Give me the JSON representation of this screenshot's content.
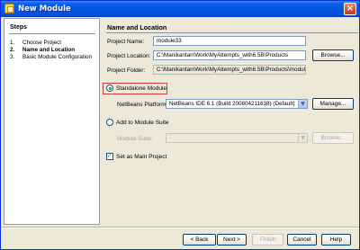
{
  "window": {
    "title": "New Module",
    "close_label": "×"
  },
  "steps": {
    "title": "Steps",
    "items": [
      {
        "num": "1.",
        "label": "Choose Project",
        "current": false
      },
      {
        "num": "2.",
        "label": "Name and Location",
        "current": true
      },
      {
        "num": "3.",
        "label": "Basic Module Configuration",
        "current": false
      }
    ]
  },
  "main": {
    "section_title": "Name and Location",
    "project_name": {
      "label": "Project Name:",
      "value": "module33"
    },
    "project_location": {
      "label": "Project Location:",
      "value": "C:\\Manikantan\\Work\\MyAttempts_with6.5B\\Products"
    },
    "project_folder": {
      "label": "Project Folder:",
      "value": "C:\\Manikantan\\Work\\MyAttempts_with6.5B\\Products\\module33"
    },
    "browse_label": "Browse...",
    "standalone_label": "Standalone Module",
    "platform": {
      "label": "NetBeans Platform:",
      "value": "NetBeans IDE 6.1 (Build 200804211638) (Default)"
    },
    "manage_label": "Manage...",
    "add_to_suite_label": "Add to Module Suite",
    "module_suite": {
      "label": "Module Suite:",
      "value": ""
    },
    "suite_browse_label": "Browse...",
    "set_main_label": "Set as Main Project"
  },
  "footer": {
    "back_label": "< Back",
    "next_label": "Next >",
    "finish_label": "Finish",
    "cancel_label": "Cancel",
    "help_label": "Help"
  },
  "colors": {
    "title_bar": "#0553e0",
    "focus_border": "#d23b3b",
    "dialog_bg": "#ece9d8"
  }
}
